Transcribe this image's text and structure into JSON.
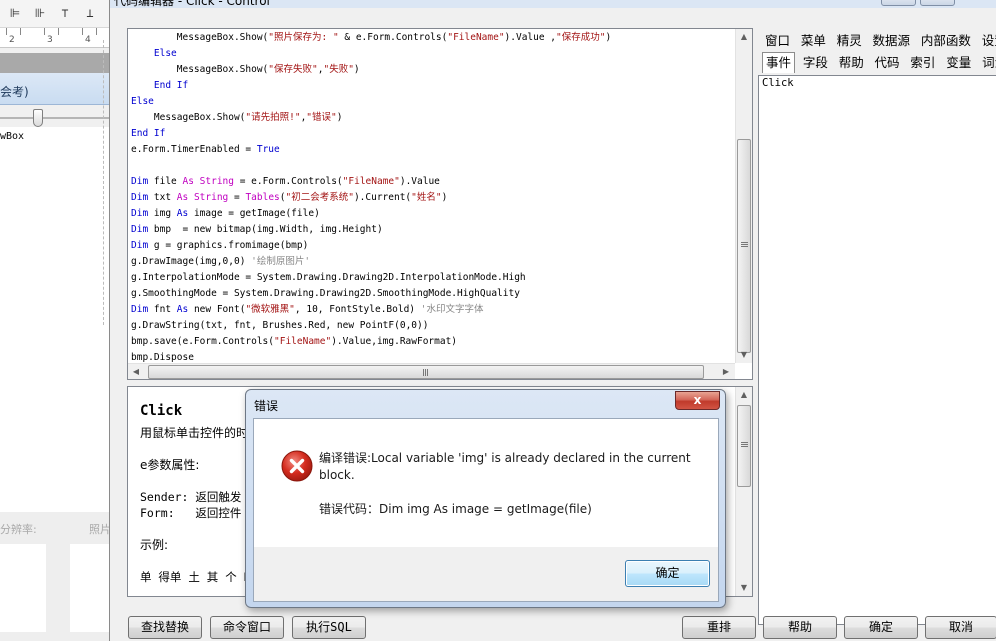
{
  "window": {
    "title": "代码编辑器 - Click - Control"
  },
  "left_background": {
    "ruler_numbers": [
      "2",
      "3",
      "4"
    ],
    "band_text": "会考)",
    "list_text": "wBox",
    "dim_labels": [
      "分辨率:",
      "照片"
    ]
  },
  "code_lines": [
    [
      {
        "t": "        MessageBox.Show("
      },
      {
        "t": "\"照片保存为: \"",
        "c": "st"
      },
      {
        "t": " & e.Form.Controls("
      },
      {
        "t": "\"FileName\"",
        "c": "st"
      },
      {
        "t": ").Value ,"
      },
      {
        "t": "\"保存成功\"",
        "c": "st"
      },
      {
        "t": ")"
      }
    ],
    [
      {
        "t": "    "
      },
      {
        "t": "Else",
        "c": "kw"
      }
    ],
    [
      {
        "t": "        MessageBox.Show("
      },
      {
        "t": "\"保存失败\"",
        "c": "st"
      },
      {
        "t": ","
      },
      {
        "t": "\"失败\"",
        "c": "st"
      },
      {
        "t": ")"
      }
    ],
    [
      {
        "t": "    "
      },
      {
        "t": "End If",
        "c": "kw"
      }
    ],
    [
      {
        "t": "Else",
        "c": "kw"
      }
    ],
    [
      {
        "t": "    MessageBox.Show("
      },
      {
        "t": "\"请先拍照!\"",
        "c": "st"
      },
      {
        "t": ","
      },
      {
        "t": "\"错误\"",
        "c": "st"
      },
      {
        "t": ")"
      }
    ],
    [
      {
        "t": "End If",
        "c": "kw"
      }
    ],
    [
      {
        "t": "e.Form.TimerEnabled = "
      },
      {
        "t": "True",
        "c": "kw"
      }
    ],
    [
      {
        "t": ""
      }
    ],
    [
      {
        "t": "Dim",
        "c": "kw"
      },
      {
        "t": " file "
      },
      {
        "t": "As String",
        "c": "ty"
      },
      {
        "t": " = e.Form.Controls("
      },
      {
        "t": "\"FileName\"",
        "c": "st"
      },
      {
        "t": ").Value"
      }
    ],
    [
      {
        "t": "Dim",
        "c": "kw"
      },
      {
        "t": " txt "
      },
      {
        "t": "As String",
        "c": "ty"
      },
      {
        "t": " = "
      },
      {
        "t": "Tables",
        "c": "ty"
      },
      {
        "t": "("
      },
      {
        "t": "\"初二会考系统\"",
        "c": "st"
      },
      {
        "t": ").Current("
      },
      {
        "t": "\"姓名\"",
        "c": "st"
      },
      {
        "t": ")"
      }
    ],
    [
      {
        "t": "Dim",
        "c": "kw"
      },
      {
        "t": " img "
      },
      {
        "t": "As",
        "c": "kw"
      },
      {
        "t": " image = getImage(file)"
      }
    ],
    [
      {
        "t": "Dim",
        "c": "kw"
      },
      {
        "t": " bmp  = new bitmap(img.Width, img.Height)"
      }
    ],
    [
      {
        "t": "Dim",
        "c": "kw"
      },
      {
        "t": " g = graphics.fromimage(bmp)"
      }
    ],
    [
      {
        "t": "g.DrawImage(img,"
      },
      {
        "t": "0",
        "c": "num"
      },
      {
        "t": ","
      },
      {
        "t": "0",
        "c": "num"
      },
      {
        "t": ") "
      },
      {
        "t": "'绘制原图片'",
        "c": "cm"
      }
    ],
    [
      {
        "t": "g.InterpolationMode = System.Drawing.Drawing2D.InterpolationMode.High"
      }
    ],
    [
      {
        "t": "g.SmoothingMode = System.Drawing.Drawing2D.SmoothingMode.HighQuality"
      }
    ],
    [
      {
        "t": "Dim",
        "c": "kw"
      },
      {
        "t": " fnt "
      },
      {
        "t": "As",
        "c": "kw"
      },
      {
        "t": " new Font("
      },
      {
        "t": "\"微软雅黑\"",
        "c": "st"
      },
      {
        "t": ", "
      },
      {
        "t": "10",
        "c": "num"
      },
      {
        "t": ", FontStyle.Bold) "
      },
      {
        "t": "'水印文字字体",
        "c": "cm"
      }
    ],
    [
      {
        "t": "g.DrawString(txt, fnt, Brushes.Red, new PointF("
      },
      {
        "t": "0",
        "c": "num"
      },
      {
        "t": ","
      },
      {
        "t": "0",
        "c": "num"
      },
      {
        "t": "))"
      }
    ],
    [
      {
        "t": "bmp.save(e.Form.Controls("
      },
      {
        "t": "\"FileName\"",
        "c": "st"
      },
      {
        "t": ").Value,img.RawFormat)"
      }
    ],
    [
      {
        "t": "bmp.Dispose"
      }
    ]
  ],
  "help": {
    "title": "Click",
    "lines": [
      {
        "text": "用鼠标单击控件的时",
        "mono": false
      },
      {
        "text": "",
        "mono": false
      },
      {
        "text": "e参数属性:",
        "mono": false
      },
      {
        "text": "",
        "mono": false
      },
      {
        "text": "Sender: 返回触发",
        "mono": true
      },
      {
        "text": "Form:   返回控件",
        "mono": true
      },
      {
        "text": "",
        "mono": false
      },
      {
        "text": "示例:",
        "mono": false
      },
      {
        "text": "",
        "mono": false
      },
      {
        "text": "单 得单 土 其 个 B  tt",
        "mono": true
      }
    ]
  },
  "right_tabs": {
    "row1": [
      "窗口",
      "菜单",
      "精灵",
      "数据源",
      "内部函数",
      "设置"
    ],
    "row2": [
      "事件",
      "字段",
      "帮助",
      "代码",
      "索引",
      "变量",
      "词汇"
    ],
    "active": "事件",
    "event_item": "Click"
  },
  "buttons": {
    "find_replace": "查找替换",
    "command_window": "命令窗口",
    "exec_sql": "执行SQL",
    "rearrange": "重排",
    "help": "帮助",
    "ok": "确定",
    "cancel": "取消"
  },
  "dialog": {
    "title": "错误",
    "close_glyph": "x",
    "message": "编译错误:Local variable 'img' is already declared in the current block.",
    "error_code": "错误代码：Dim img As image = getImage(file)",
    "ok_label": "确定"
  },
  "colors": {
    "keyword": "#0000d0",
    "type": "#c000c0",
    "string": "#a31515",
    "comment": "#888888",
    "error_icon": "#d42b1e"
  }
}
